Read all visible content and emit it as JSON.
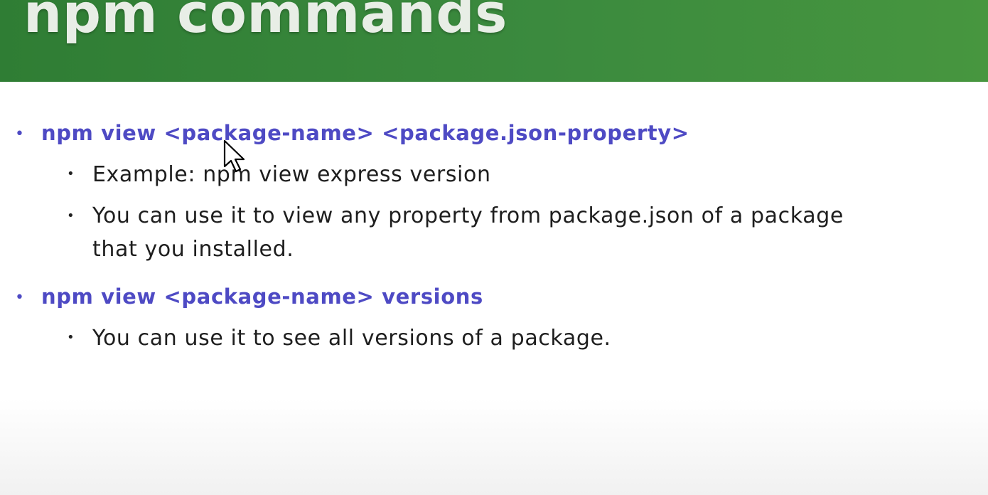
{
  "slide": {
    "title": "npm commands"
  },
  "items": [
    {
      "command": "npm view <package-name> <package.json-property>",
      "details": [
        "Example: npm view express version",
        "You can use it to view any property from package.json of a package",
        "that you installed."
      ]
    },
    {
      "command": "npm view <package-name> versions",
      "details": [
        "You can use it to see all versions of a package."
      ]
    }
  ],
  "colors": {
    "header_green": "#3b8a3e",
    "command_purple": "#4e4ac4",
    "title_text": "#e8eee6"
  },
  "icons": {
    "cursor": "mouse-pointer-icon",
    "bullet": "bullet-dot-icon"
  }
}
